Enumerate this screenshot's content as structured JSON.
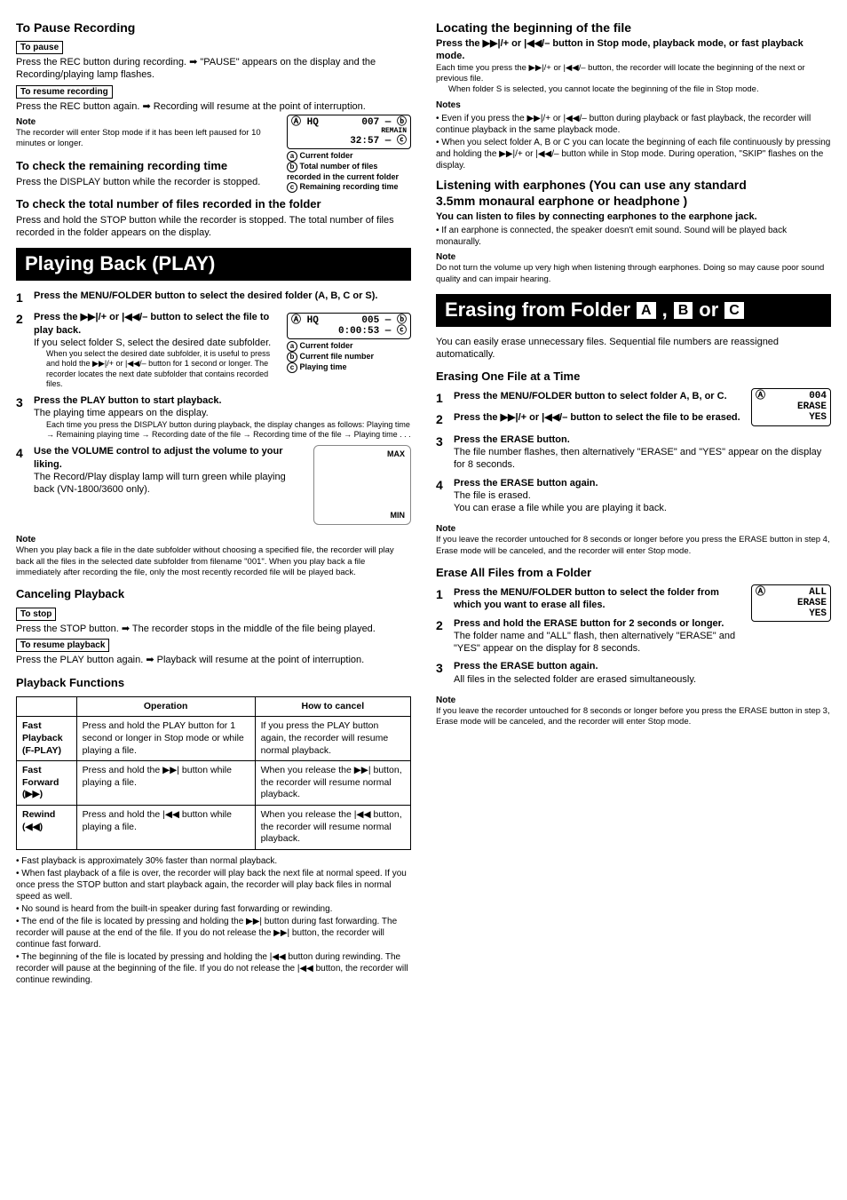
{
  "left": {
    "pause_h": "To Pause Recording",
    "pause_lbl": "To pause",
    "pause_txt1": "Press the REC button during recording.",
    "pause_txt2": "\"PAUSE\" appears on the display and the Recording/playing lamp flashes.",
    "resume_lbl": "To resume recording",
    "resume_txt1": "Press the REC button again.",
    "resume_txt2": "Recording will resume at the point of interruption.",
    "note_h": "Note",
    "note_txt": "The recorder will enter Stop mode if it has been left paused for 10 minutes or longer.",
    "remain_h": "To check the remaining recording time",
    "remain_txt": "Press the DISPLAY button while the recorder is stopped.",
    "fig1_a": "Current folder",
    "fig1_b": "Total number of files recorded in the current folder",
    "fig1_c": "Remaining recording time",
    "total_h": "To check the total number of files recorded in the folder",
    "total_txt": "Press and hold the STOP button while the recorder is stopped. The total number of files recorded in the folder appears on the display.",
    "play_bar": "Playing Back (PLAY)",
    "p1_head": "Press the MENU/FOLDER button to select the desired folder (A, B, C or S).",
    "p2_head": "Press the ▶▶|/+ or |◀◀/– button to select the file to play back.",
    "p2_sub1": "If you select folder S, select the desired date subfolder.",
    "p2_sub2": "When you select the desired date subfolder, it is useful to press and hold the ▶▶|/+ or |◀◀/– button for 1 second or longer. The recorder locates the next date subfolder that contains recorded files.",
    "fig2_a": "Current folder",
    "fig2_b": "Current file number",
    "fig2_c": "Playing time",
    "p3_head": "Press the PLAY button to start playback.",
    "p3_sub1": "The playing time   appears on the display.",
    "p3_sub2": "Each time you press the DISPLAY button during playback, the display changes as follows: Playing time → Remaining playing time → Recording date of the file → Recording time of the file → Playing time . . .",
    "p4_head": "Use the VOLUME control to adjust the volume to your liking.",
    "p4_sub": "The Record/Play display lamp will turn green while playing back (VN-1800/3600 only).",
    "vol_max": "MAX",
    "vol_min": "MIN",
    "pnote_h": "Note",
    "pnote_txt": "When you play back a file in the date subfolder without choosing a specified file, the recorder will play back all the files in the selected date subfolder from filename \"001\". When you play back a file immediately after recording the file, only the most recently recorded file will be played back.",
    "cancel_h": "Canceling Playback",
    "stop_lbl": "To stop",
    "stop_txt1": "Press the STOP button.",
    "stop_txt2": "The recorder stops in the middle of the file being played.",
    "resp_lbl": "To resume playback",
    "resp_txt1": "Press the PLAY button again.",
    "resp_txt2": "Playback will resume at the point of interruption.",
    "func_h": "Playback Functions",
    "th1": "",
    "th2": "Operation",
    "th3": "How to cancel",
    "r1c1a": "Fast Playback",
    "r1c1b": "(F-PLAY)",
    "r1c2": "Press and hold the PLAY button for 1 second or longer in Stop mode or while playing a file.",
    "r1c3": "If you press the PLAY button again, the recorder will resume normal playback.",
    "r2c1a": "Fast Forward",
    "r2c1b": "(▶▶)",
    "r2c2": "Press and hold the ▶▶| button while playing a file.",
    "r2c3": "When you release the ▶▶| button, the recorder will resume normal playback.",
    "r3c1": "Rewind (◀◀)",
    "r3c2": "Press and hold the |◀◀ button while playing a file.",
    "r3c3": "When you release the |◀◀ button, the recorder will resume normal playback.",
    "b1": "Fast playback is approximately 30% faster than normal playback.",
    "b2": "When fast playback of a file is over, the recorder will play back the next file at normal speed. If you once press the STOP button and start playback again, the recorder will play back files in normal speed as well.",
    "b3": "No sound is heard from the built-in speaker during fast forwarding or rewinding.",
    "b4": "The end of the file is located by pressing and holding the ▶▶| button during fast forwarding. The recorder will pause at the end of the file. If you do not release the ▶▶| button, the recorder will continue fast forward.",
    "b5": "The beginning of the file is located by pressing and holding the |◀◀ button during rewinding. The recorder will pause at the beginning of the file. If you do not release the |◀◀ button, the recorder will continue rewinding."
  },
  "right": {
    "loc_h": "Locating the beginning of the file",
    "loc_b": "Press the ▶▶|/+ or |◀◀/– button in Stop mode, playback mode, or fast playback mode.",
    "loc_t1": "Each time you press the ▶▶|/+ or |◀◀/– button, the recorder will locate the beginning of the next or previous file.",
    "loc_t2": "When folder S is selected, you cannot locate the beginning of the file in Stop mode.",
    "loc_nh": "Notes",
    "loc_n1": "Even if you press the ▶▶|/+ or |◀◀/– button during playback or fast playback, the recorder will continue playback in the same playback mode.",
    "loc_n2": "When you select folder A, B or C you can locate the beginning of each file continuously by pressing and holding the ▶▶|/+ or |◀◀/– button while in Stop mode. During operation, \"SKIP\" flashes on the display.",
    "ear_h1": "Listening with earphones (You can use any standard",
    "ear_h2": "3.5mm monaural earphone or headphone )",
    "ear_b": "You can listen to files by connecting earphones to the earphone jack.",
    "ear_t": "If an earphone is connected, the speaker doesn't emit sound. Sound will be played back monaurally.",
    "ear_nh": "Note",
    "ear_n": "Do not turn the volume up very high when listening through earphones. Doing so may cause poor sound quality and can impair hearing.",
    "erase_bar_pre": "Erasing from Folder ",
    "erase_bar_or": " or ",
    "erase_intro": "You can easily erase unnecessary files. Sequential file numbers are reassigned automatically.",
    "e1_h": "Erasing One File at a Time",
    "e1s1": "Press the MENU/FOLDER button to select folder A, B, or C.",
    "e1s2": "Press the ▶▶|/+ or |◀◀/– button to select the file to be erased.",
    "e1s3": "Press the ERASE button.",
    "e1s3t": "The file number flashes, then alternatively \"ERASE\" and \"YES\" appear on the display for 8 seconds.",
    "e1s4": "Press the ERASE button again.",
    "e1s4t1": "The file is erased.",
    "e1s4t2": "You can erase a file while you are playing it back.",
    "e1_nh": "Note",
    "e1_n": "If you leave the recorder untouched for 8 seconds or longer before you press the ERASE button in step 4, Erase mode will be canceled, and the recorder will enter Stop mode.",
    "e2_h": "Erase All Files from a Folder",
    "e2s1": "Press the MENU/FOLDER button to select the folder from which you want to erase all files.",
    "e2s2a": "Press and hold the ERASE button for ",
    "e2s2b": "2 seconds or longer.",
    "e2s2t": "The folder name and \"ALL\" flash, then alternatively \"ERASE\" and \"YES\" appear on the display for 8 seconds.",
    "e2s3": "Press the ERASE button again.",
    "e2s3t": "All files in the selected folder are erased simultaneously.",
    "e2_nh": "Note",
    "e2_n": "If you leave the recorder untouched for 8 seconds or longer before you press the ERASE button in step 3, Erase mode will be canceled, and the recorder will enter Stop mode.",
    "lcd_era": "ERASE",
    "lcd_yes": "YES",
    "lcd_all": "ALL"
  }
}
